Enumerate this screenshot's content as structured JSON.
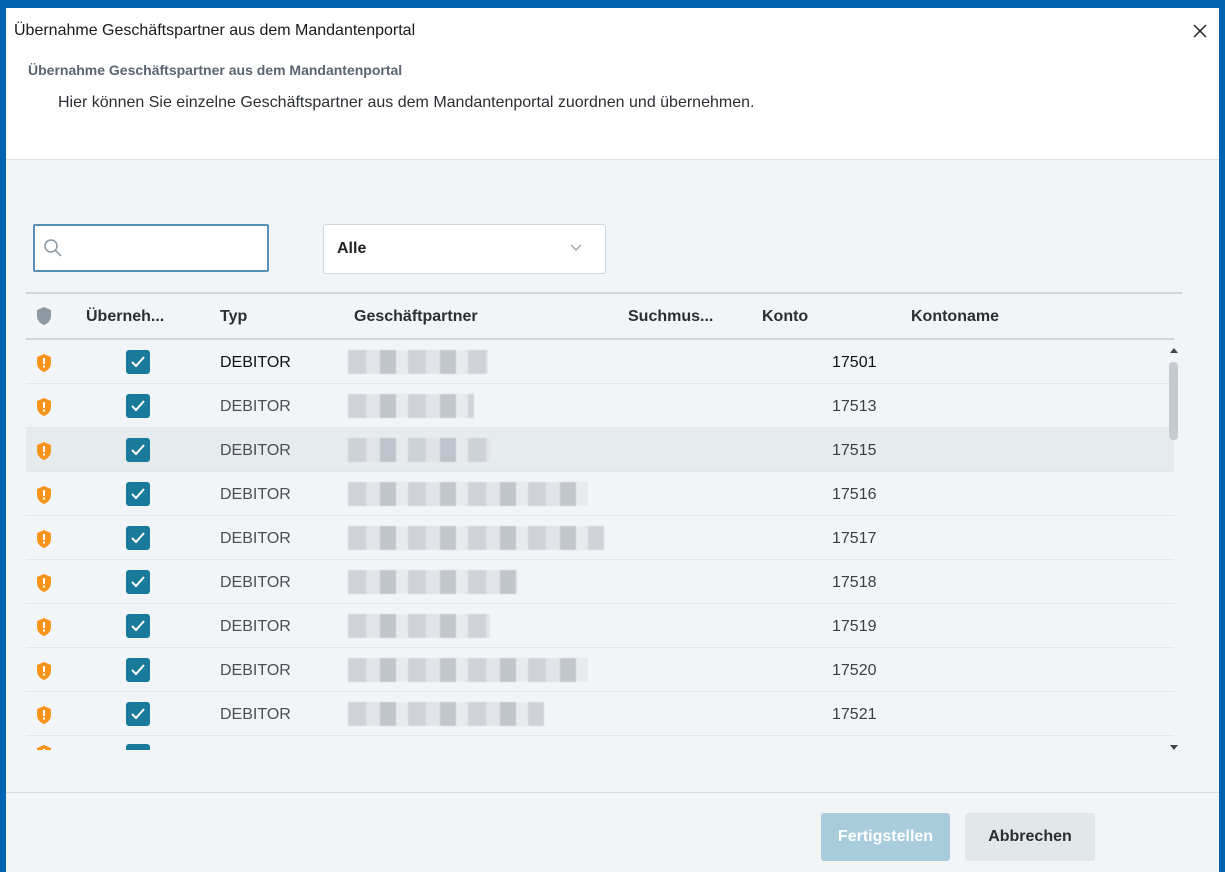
{
  "window": {
    "title": "Übernahme Geschäftspartner aus dem Mandantenportal",
    "close_icon": "close-icon"
  },
  "header": {
    "title": "Übernahme Geschäftspartner aus dem Mandantenportal",
    "description": "Hier können Sie einzelne Geschäftspartner aus dem Mandantenportal zuordnen und übernehmen."
  },
  "search": {
    "value": "",
    "placeholder": "",
    "icon": "search-icon"
  },
  "filter": {
    "selected": "Alle",
    "icon": "chevron-down-icon"
  },
  "grid": {
    "columns": {
      "status": "shield-icon",
      "take": "Überneh...",
      "type": "Typ",
      "partner": "Geschäftpartner",
      "search_pattern": "Suchmus...",
      "account": "Konto",
      "account_name": "Kontoname"
    },
    "rows": [
      {
        "type": "DEBITOR",
        "partner": "",
        "account": "17501",
        "checked": true
      },
      {
        "type": "DEBITOR",
        "partner": "",
        "account": "17513",
        "checked": true
      },
      {
        "type": "DEBITOR",
        "partner": "",
        "account": "17515",
        "checked": true
      },
      {
        "type": "DEBITOR",
        "partner": "",
        "account": "17516",
        "checked": true
      },
      {
        "type": "DEBITOR",
        "partner": "",
        "account": "17517",
        "checked": true
      },
      {
        "type": "DEBITOR",
        "partner": "",
        "account": "17518",
        "checked": true
      },
      {
        "type": "DEBITOR",
        "partner": "",
        "account": "17519",
        "checked": true
      },
      {
        "type": "DEBITOR",
        "partner": "",
        "account": "17520",
        "checked": true
      },
      {
        "type": "DEBITOR",
        "partner": "",
        "account": "17521",
        "checked": true
      }
    ],
    "selected_row": 2
  },
  "footer": {
    "finish_label": "Fertigstellen",
    "cancel_label": "Abbrechen"
  },
  "colors": {
    "accent": "#1a7a9a",
    "warning": "#f7941d",
    "border": "#0063b1"
  }
}
